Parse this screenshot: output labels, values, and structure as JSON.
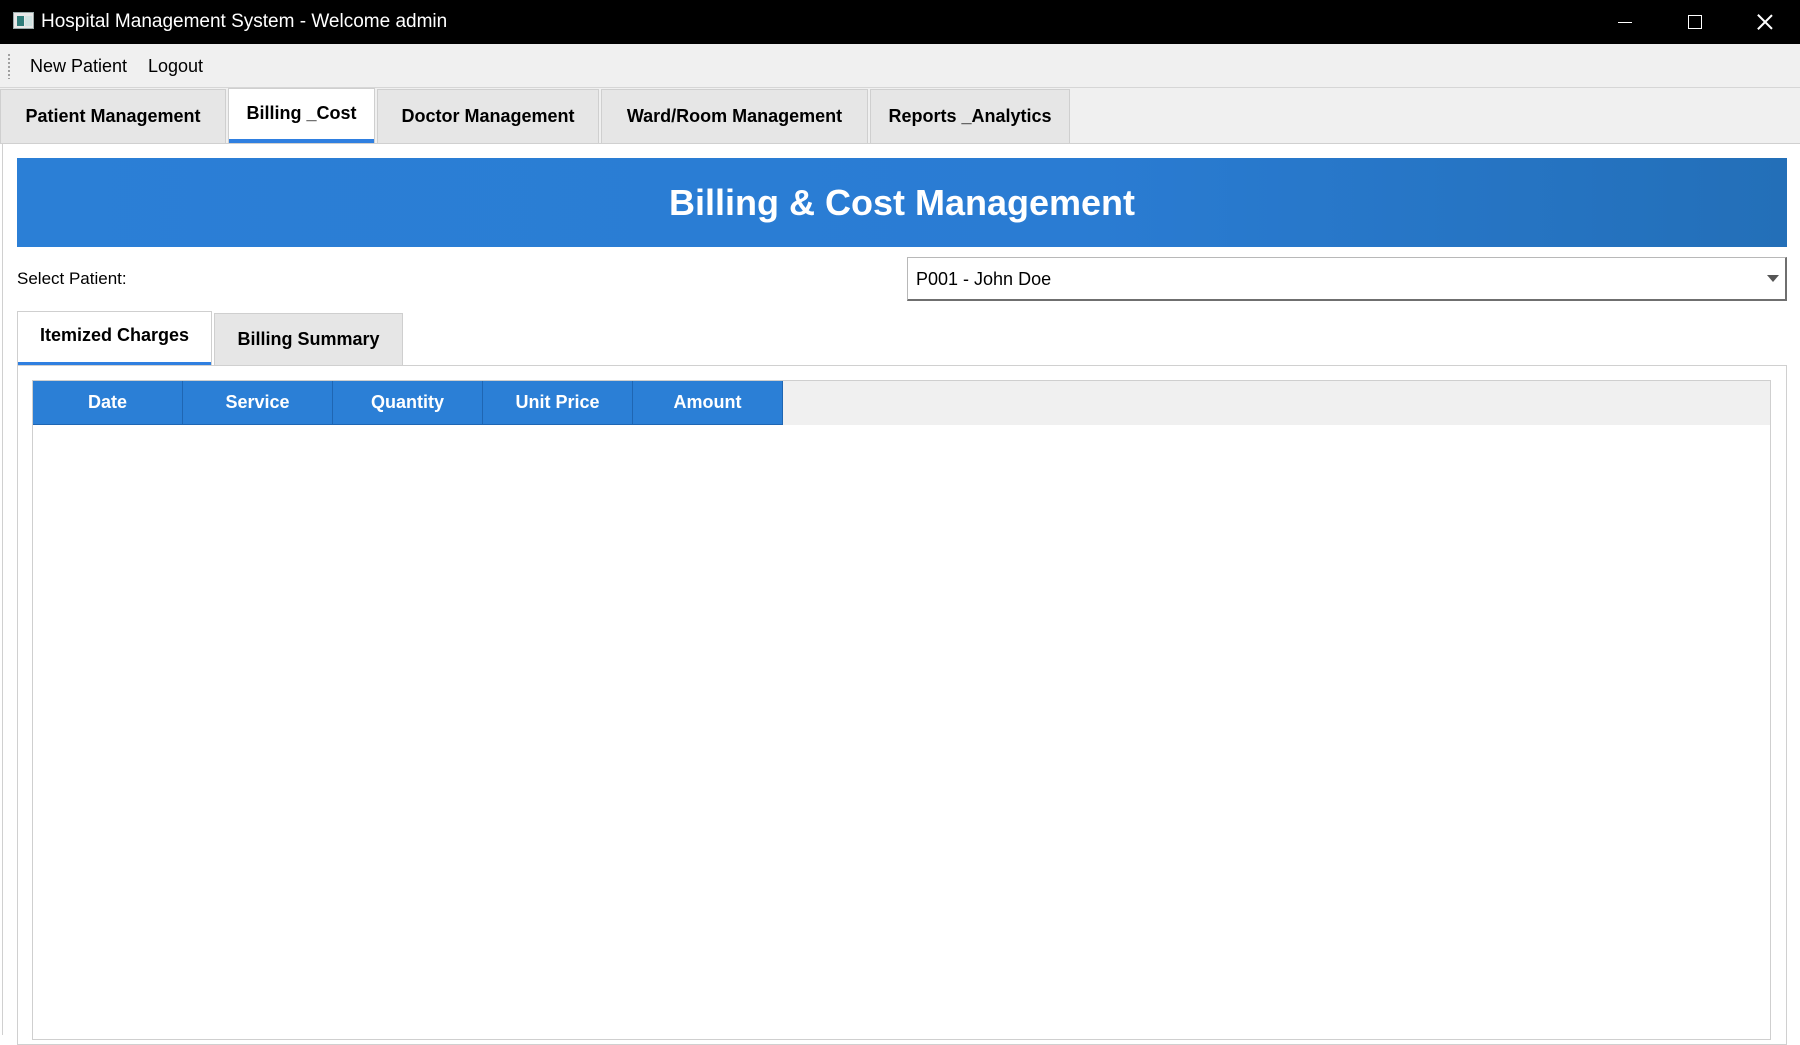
{
  "window": {
    "title": "Hospital Management System - Welcome admin",
    "icon": "app-window-icon",
    "controls": [
      "minimize-icon",
      "maximize-icon",
      "close-icon"
    ]
  },
  "menu": {
    "items": [
      "New Patient",
      "Logout"
    ]
  },
  "tabs": [
    {
      "label": "Patient Management",
      "active": false
    },
    {
      "label": "Billing _Cost",
      "active": true
    },
    {
      "label": "Doctor Management",
      "active": false
    },
    {
      "label": "Ward/Room Management",
      "active": false
    },
    {
      "label": "Reports _Analytics",
      "active": false
    }
  ],
  "billing": {
    "header": "Billing & Cost Management",
    "select_label": "Select Patient:",
    "selected_patient": "P001 - John Doe",
    "inner_tabs": [
      {
        "label": "Itemized Charges",
        "active": true
      },
      {
        "label": "Billing Summary",
        "active": false
      }
    ],
    "table": {
      "columns": [
        "Date",
        "Service",
        "Quantity",
        "Unit Price",
        "Amount"
      ],
      "rows": []
    }
  },
  "colors": {
    "accent": "#2b7fd6",
    "titlebar": "#000000",
    "chrome": "#f0f0f0"
  }
}
